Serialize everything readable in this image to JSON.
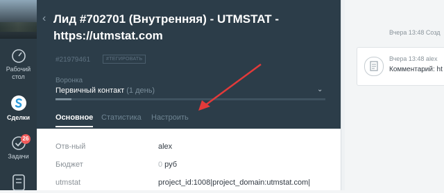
{
  "sidebar": {
    "items": [
      {
        "label": "Рабочий стол",
        "line1": "Рабочий",
        "line2": "стол",
        "icon": "dashboard-gauge-icon"
      },
      {
        "label": "Сделки",
        "icon": "deals-icon"
      },
      {
        "label": "Задачи",
        "icon": "tasks-check-icon",
        "badge": "26"
      },
      {
        "label": "",
        "icon": "lists-icon"
      }
    ]
  },
  "lead": {
    "title": "Лид #702701 (Внутренняя) - UTMSTAT - https://utmstat.com",
    "id": "#21979461",
    "tag_button": "#ТЕГИРОВАТЬ",
    "funnel_label": "Воронка",
    "stage": "Первичный контакт",
    "stage_duration": "(1 день)",
    "stage_progress": 0.06,
    "tabs": [
      "Основное",
      "Статистика",
      "Настроить"
    ]
  },
  "fields": [
    {
      "label": "Отв-ный",
      "value": "alex"
    },
    {
      "label": "Бюджет",
      "value_zero": "0",
      "value_unit": " руб"
    },
    {
      "label": "utmstat",
      "value": "project_id:1008|project_domain:utmstat.com|"
    }
  ],
  "feed": {
    "time1": "Вчера 13:48 Созд",
    "note_time": "Вчера 13:48 alex",
    "note_text": "Комментарий: ht"
  },
  "colors": {
    "header_bg": "#2c3d49",
    "sidebar_bg": "#2b3a44",
    "arrow": "#e23a3a",
    "badge": "#f05b5b"
  }
}
